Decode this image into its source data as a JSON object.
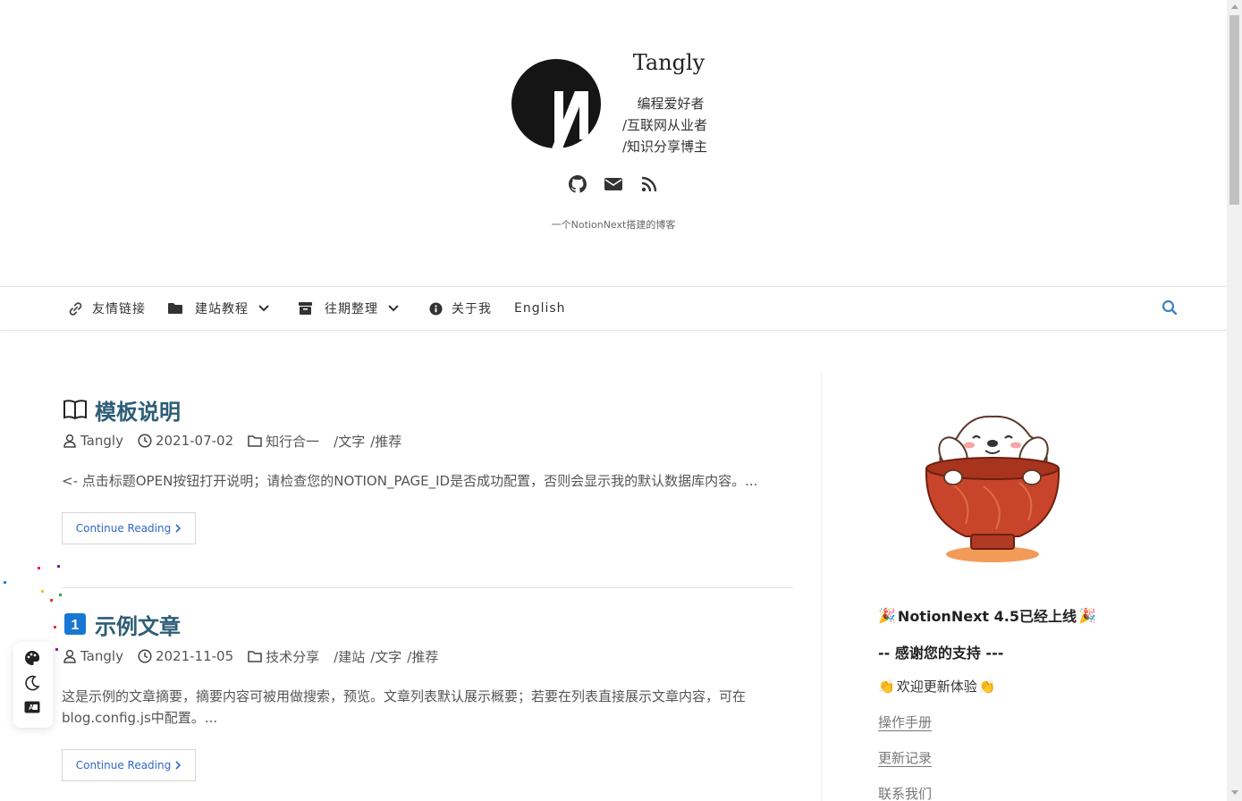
{
  "header": {
    "site_title": "Tangly",
    "bio_lines": [
      "编程爱好者",
      "/互联网从业者",
      "/知识分享博主"
    ],
    "description": "一个NotionNext搭建的博客",
    "social_icons": [
      "github-icon",
      "mail-icon",
      "rss-icon"
    ]
  },
  "nav": {
    "items": [
      {
        "label": "友情链接",
        "icon": "link-icon"
      },
      {
        "label": "建站教程",
        "icon": "folder-icon",
        "dropdown": true
      },
      {
        "label": "往期整理",
        "icon": "archive-icon",
        "dropdown": true
      },
      {
        "label": "关于我",
        "icon": "info-icon"
      },
      {
        "label": "English"
      }
    ],
    "search_icon": "search-icon"
  },
  "posts": [
    {
      "emoji": "📖",
      "title": "模板说明",
      "author": "Tangly",
      "date": "2021-07-02",
      "category": "知行合一",
      "tags": [
        "/文字",
        "/推荐"
      ],
      "excerpt": "<- 点击标题OPEN按钮打开说明；请检查您的NOTION_PAGE_ID是否成功配置，否则会显示我的默认数据库内容。...",
      "button_label": "Continue Reading"
    },
    {
      "emoji": "1️⃣",
      "title": "示例文章",
      "author": "Tangly",
      "date": "2021-11-05",
      "category": "技术分享",
      "tags": [
        "/建站",
        "/文字",
        "/推荐"
      ],
      "excerpt": "这是示例的文章摘要，摘要内容可被用做搜索，预览。文章列表默认展示概要；若要在列表直接展示文章内容，可在blog.config.js中配置。...",
      "button_label": "Continue Reading"
    }
  ],
  "sidebar": {
    "announcement_title": "NotionNext 4.5已经上线",
    "thanks": "-- 感谢您的支持 ---",
    "welcome": "欢迎更新体验",
    "links": [
      "操作手册",
      "更新记录",
      "联系我们"
    ]
  },
  "floating": {
    "icons": [
      "palette-icon",
      "moon-icon",
      "translate-icon"
    ]
  },
  "colors": {
    "title": "#2e5d76",
    "link_button": "#2f67c7",
    "search": "#3b82c4"
  }
}
